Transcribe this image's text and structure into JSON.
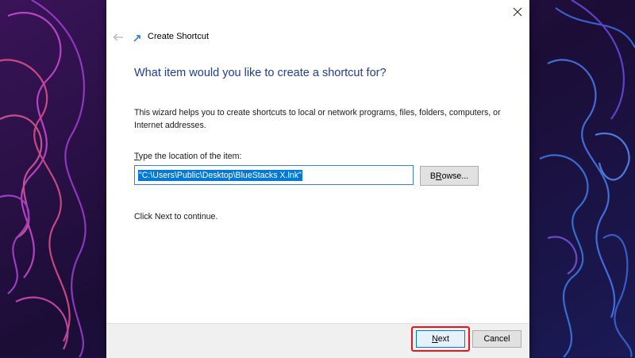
{
  "window": {
    "title": "Create Shortcut",
    "icons": {
      "close": "close-icon",
      "back": "back-arrow-icon",
      "title": "shortcut-icon"
    }
  },
  "wizard": {
    "heading": "What item would you like to create a shortcut for?",
    "description": "This wizard helps you to create shortcuts to local or network programs, files, folders, computers, or Internet addresses.",
    "location_label_accel": "T",
    "location_label_rest": "ype the location of the item:",
    "location_value": "\"C:\\Users\\Public\\Desktop\\BlueStacks X.lnk\"",
    "browse_accel": "R",
    "browse_prefix": "B",
    "browse_rest": "owse...",
    "continue_text": "Click Next to continue."
  },
  "footer": {
    "next_accel": "N",
    "next_rest": "ext",
    "cancel_label": "Cancel"
  },
  "colors": {
    "heading": "#1f3d96",
    "selection": "#0078d7",
    "highlight": "#e8141e",
    "background": "#23103f"
  }
}
